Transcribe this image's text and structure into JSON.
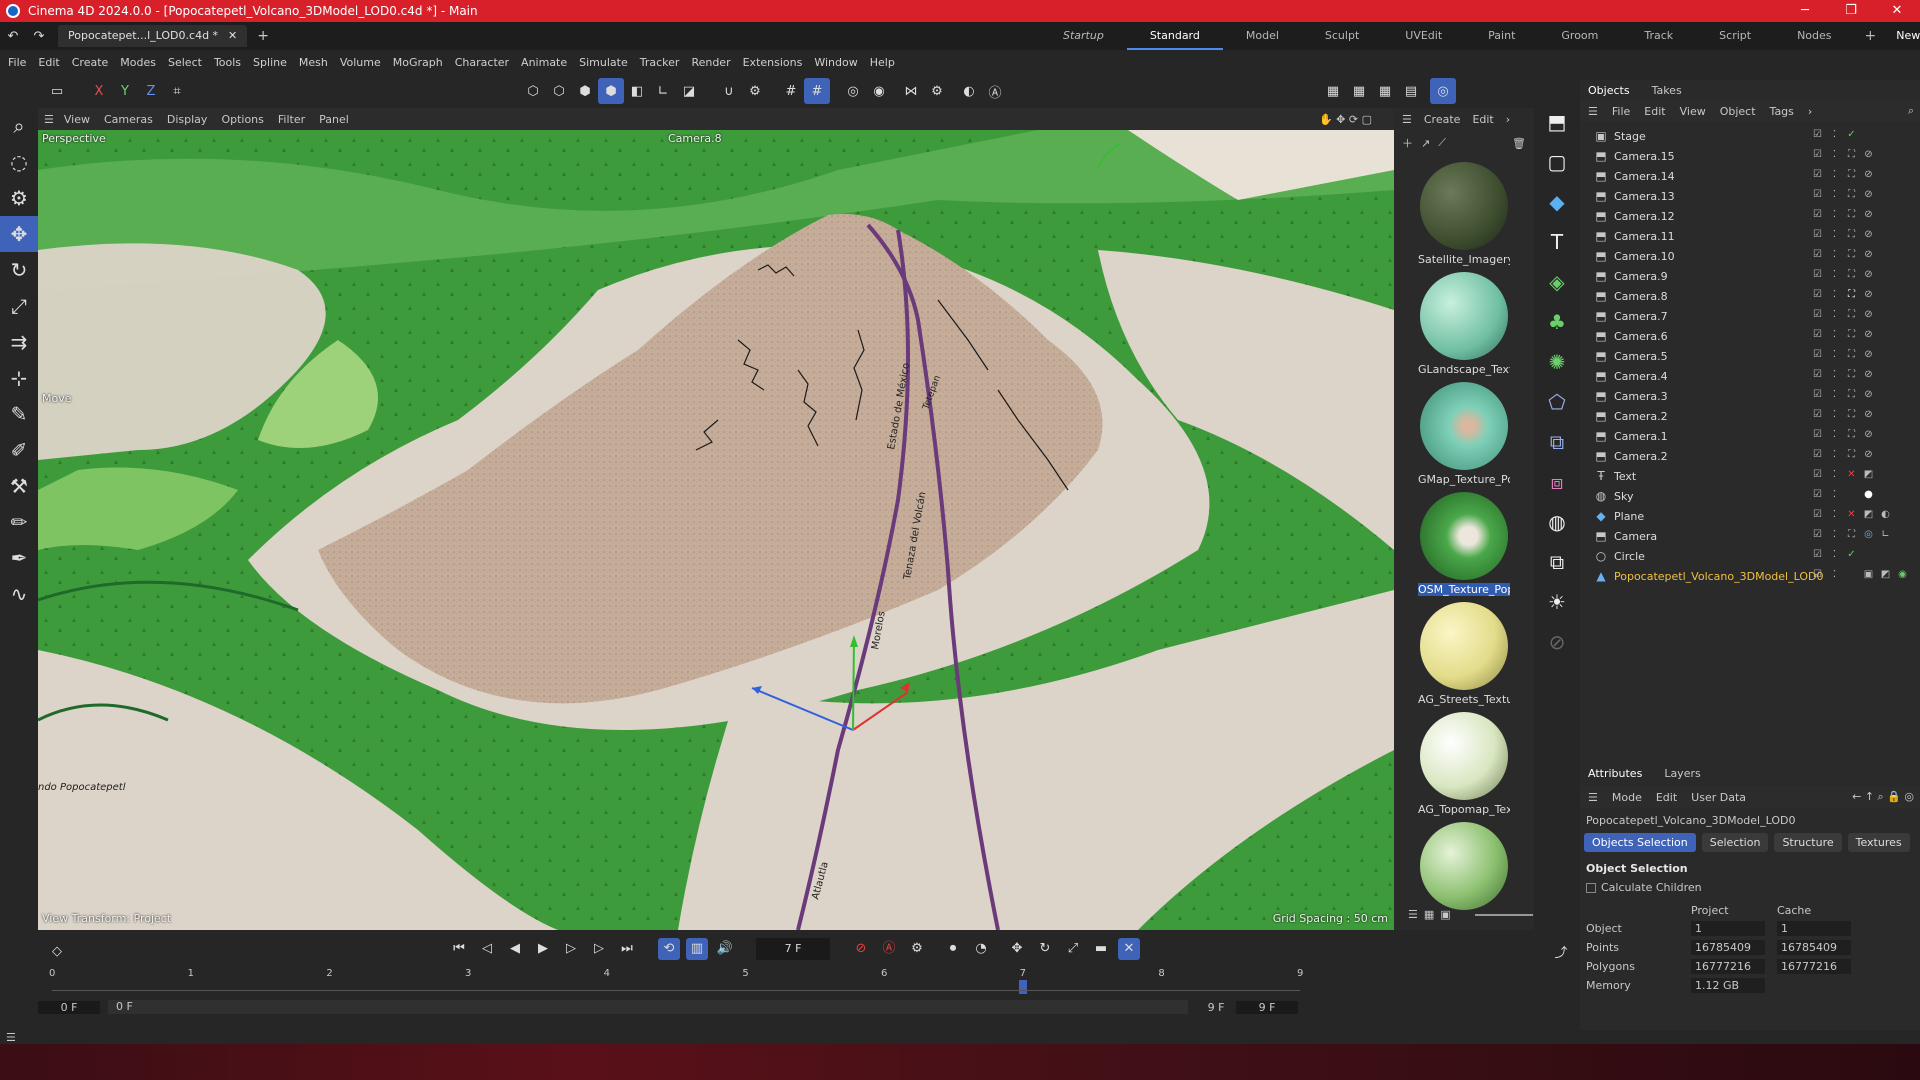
{
  "window": {
    "title": "Cinema 4D 2024.0.0 - [Popocatepetl_Volcano_3DModel_LOD0.c4d *] - Main",
    "controls": [
      "─",
      "❐",
      "✕"
    ]
  },
  "doc_tab": {
    "label": "Popocatepet...l_LOD0.c4d *",
    "close": "✕",
    "add": "+"
  },
  "layouts": {
    "tabs": [
      "Startup",
      "Standard",
      "Model",
      "Sculpt",
      "UVEdit",
      "Paint",
      "Groom",
      "Track",
      "Script",
      "Nodes"
    ],
    "active": "Standard",
    "add": "+",
    "new_layouts": "New Layouts"
  },
  "menu": [
    "File",
    "Edit",
    "Create",
    "Modes",
    "Select",
    "Tools",
    "Spline",
    "Mesh",
    "Volume",
    "MoGraph",
    "Character",
    "Animate",
    "Simulate",
    "Tracker",
    "Render",
    "Extensions",
    "Window",
    "Help"
  ],
  "axes": {
    "x": "X",
    "y": "Y",
    "z": "Z"
  },
  "viewport": {
    "menu": [
      "View",
      "Cameras",
      "Display",
      "Options",
      "Filter",
      "Panel"
    ],
    "projection": "Perspective",
    "camera": "Camera.8",
    "tool_label": "Move",
    "view_transform": "View Transform: Project",
    "grid_spacing": "Grid Spacing : 50 cm",
    "map_labels": [
      "Estado de México",
      "Morelos",
      "Tenaza del Volcán",
      "Atlautla",
      "ndo Popocatepetl",
      "Tetepan"
    ]
  },
  "materials": {
    "menu": [
      "Create",
      "Edit"
    ],
    "items": [
      {
        "name": "Satellite_Imagery_",
        "color": "#3d4d2e",
        "selected": false
      },
      {
        "name": "GLandscape_Textu",
        "color": "#6fbfa2",
        "selected": false
      },
      {
        "name": "GMap_Texture_Po",
        "color": "#7fd0b8",
        "selected": false
      },
      {
        "name": "OSM_Texture_Pop",
        "color": "#4aa84a",
        "selected": true
      },
      {
        "name": "AG_Streets_Textur",
        "color": "#e2dc8a",
        "selected": false
      },
      {
        "name": "AG_Topomap_Tex",
        "color": "#d8e6c0",
        "selected": false
      },
      {
        "name": "",
        "color": "#8cc070",
        "selected": false
      }
    ]
  },
  "objects_panel": {
    "tabs": [
      "Objects",
      "Takes"
    ],
    "menu": [
      "File",
      "Edit",
      "View",
      "Object",
      "Tags"
    ],
    "items": [
      {
        "name": "Stage",
        "icon": "stage-icon"
      },
      {
        "name": "Camera.15",
        "icon": "camera-icon"
      },
      {
        "name": "Camera.14",
        "icon": "camera-icon"
      },
      {
        "name": "Camera.13",
        "icon": "camera-icon"
      },
      {
        "name": "Camera.12",
        "icon": "camera-icon"
      },
      {
        "name": "Camera.11",
        "icon": "camera-icon"
      },
      {
        "name": "Camera.10",
        "icon": "camera-icon"
      },
      {
        "name": "Camera.9",
        "icon": "camera-icon"
      },
      {
        "name": "Camera.8",
        "icon": "camera-icon"
      },
      {
        "name": "Camera.7",
        "icon": "camera-icon"
      },
      {
        "name": "Camera.6",
        "icon": "camera-icon"
      },
      {
        "name": "Camera.5",
        "icon": "camera-icon"
      },
      {
        "name": "Camera.4",
        "icon": "camera-icon"
      },
      {
        "name": "Camera.3",
        "icon": "camera-icon"
      },
      {
        "name": "Camera.2",
        "icon": "camera-icon"
      },
      {
        "name": "Camera.1",
        "icon": "camera-icon"
      },
      {
        "name": "Camera.2",
        "icon": "camera-icon"
      },
      {
        "name": "Text",
        "icon": "text-icon"
      },
      {
        "name": "Sky",
        "icon": "sky-icon"
      },
      {
        "name": "Plane",
        "icon": "plane-icon"
      },
      {
        "name": "Camera",
        "icon": "camera-icon"
      },
      {
        "name": "Circle",
        "icon": "circle-icon"
      },
      {
        "name": "Popocatepetl_Volcano_3DModel_LOD0",
        "icon": "polygon-object-icon",
        "highlight": true
      }
    ]
  },
  "attributes": {
    "tabs": [
      "Attributes",
      "Layers"
    ],
    "menu": [
      "Mode",
      "Edit",
      "User Data"
    ],
    "object_name": "Popocatepetl_Volcano_3DModel_LOD0",
    "buttons": [
      "Objects Selection",
      "Selection",
      "Structure",
      "Textures"
    ],
    "section": "Object Selection",
    "calculate_children": "Calculate Children",
    "columns": [
      "Project",
      "Cache"
    ],
    "rows": [
      {
        "label": "Object",
        "project": "1",
        "cache": "1"
      },
      {
        "label": "Points",
        "project": "16785409",
        "cache": "16785409"
      },
      {
        "label": "Polygons",
        "project": "16777216",
        "cache": "16777216"
      },
      {
        "label": "Memory",
        "project": "1.12 GB",
        "cache": ""
      }
    ]
  },
  "timeline": {
    "current_frame": "7 F",
    "current_frame_value": 7,
    "ticks": [
      "0",
      "1",
      "2",
      "3",
      "4",
      "5",
      "6",
      "7",
      "8",
      "9"
    ],
    "start_field": "0 F",
    "start_field2": "0 F",
    "end_field": "9 F",
    "end_field2": "9 F",
    "max_frame": 9
  },
  "colors": {
    "accent": "#3f63b8",
    "titlebar": "#d8202b",
    "terrain_green": "#3d9a3a",
    "terrain_snow": "#dcd4c8",
    "terrain_rock": "#c4ab98"
  }
}
